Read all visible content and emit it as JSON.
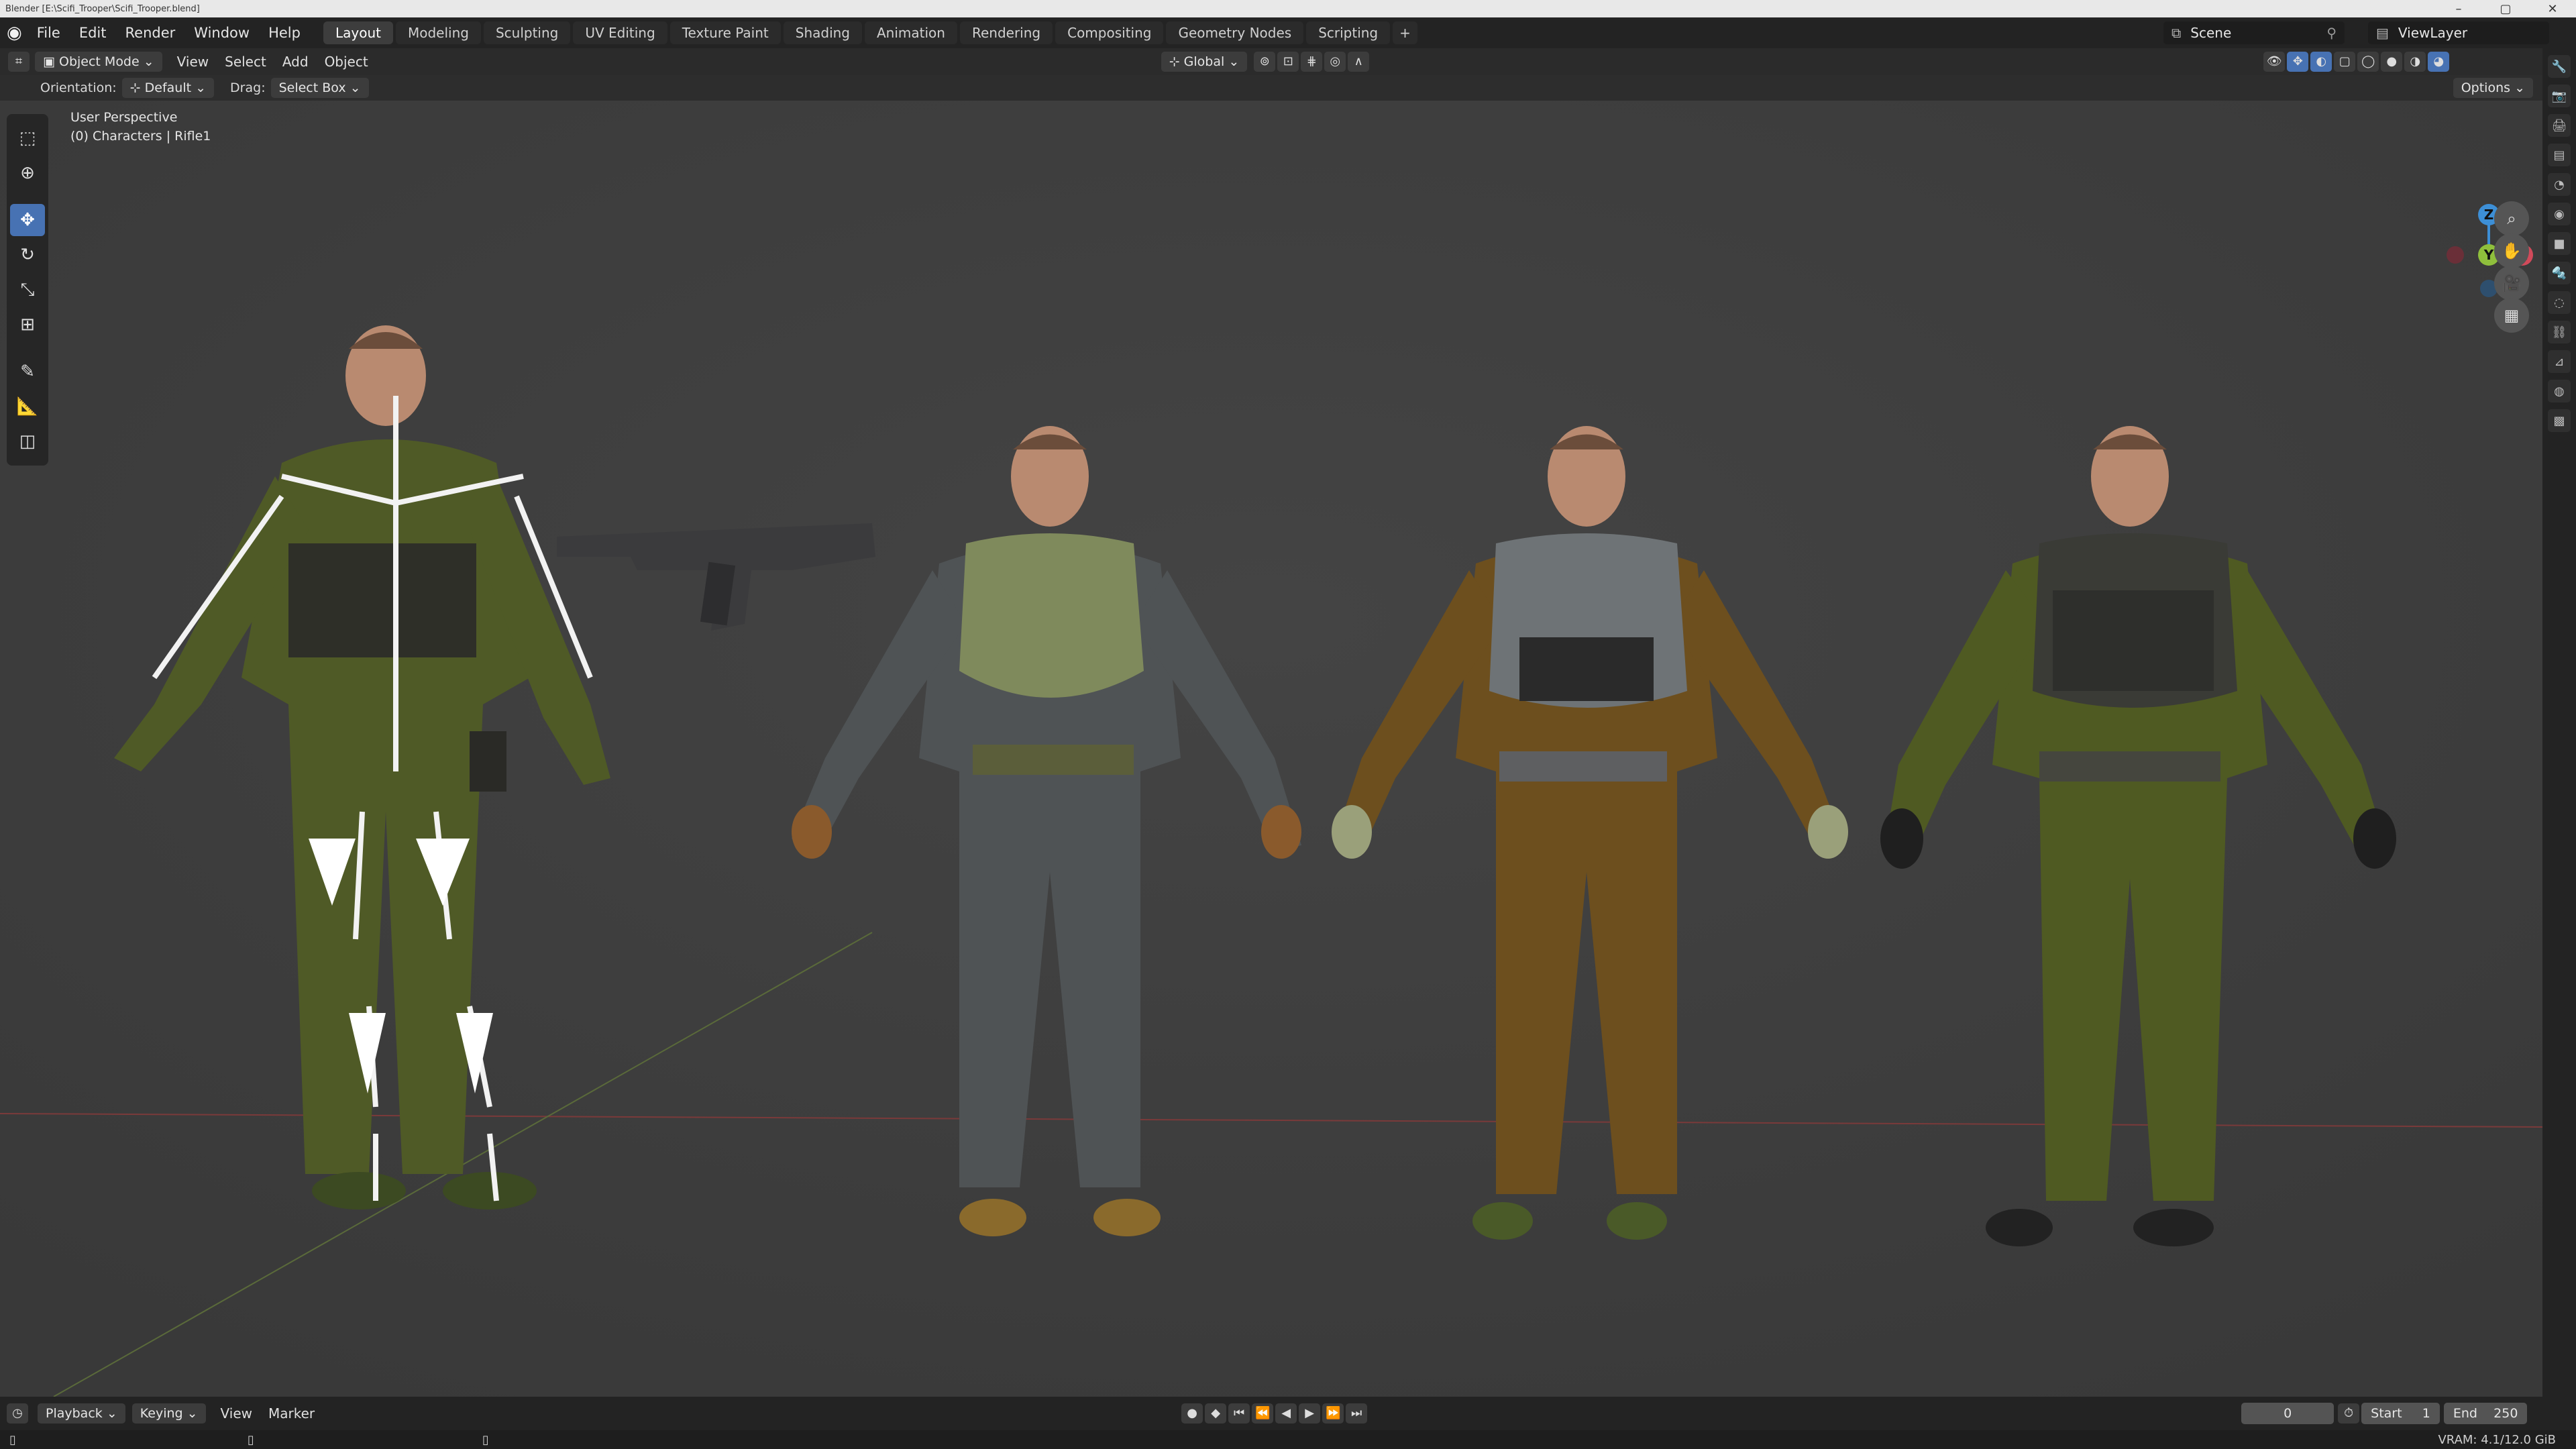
{
  "window": {
    "title": "Blender [E:\\Scifi_Trooper\\Scifi_Trooper.blend]",
    "controls": [
      "–",
      "▢",
      "✕"
    ]
  },
  "menu": [
    "File",
    "Edit",
    "Render",
    "Window",
    "Help"
  ],
  "workspaces": [
    {
      "label": "Layout",
      "active": true
    },
    {
      "label": "Modeling"
    },
    {
      "label": "Sculpting"
    },
    {
      "label": "UV Editing"
    },
    {
      "label": "Texture Paint"
    },
    {
      "label": "Shading"
    },
    {
      "label": "Animation"
    },
    {
      "label": "Rendering"
    },
    {
      "label": "Compositing"
    },
    {
      "label": "Geometry Nodes"
    },
    {
      "label": "Scripting"
    }
  ],
  "add_workspace": "+",
  "scene": {
    "label": "Scene"
  },
  "viewlayer": {
    "label": "ViewLayer"
  },
  "header": {
    "mode": "Object Mode",
    "menus": [
      "View",
      "Select",
      "Add",
      "Object"
    ],
    "transform_orientation": "Global"
  },
  "tool_settings": {
    "orientation_label": "Orientation:",
    "orientation_value": "Default",
    "drag_label": "Drag:",
    "drag_value": "Select Box",
    "options": "Options"
  },
  "viewport": {
    "perspective": "User Perspective",
    "collection_info": "(0) Characters | Rifle1",
    "gizmo_axes": {
      "z": "Z",
      "y": "Y",
      "x": "X"
    }
  },
  "timeline": {
    "playback": "Playback",
    "keying": "Keying",
    "view": "View",
    "marker": "Marker",
    "current_frame": "0",
    "start_label": "Start",
    "start": "1",
    "end_label": "End",
    "end": "250"
  },
  "status": {
    "vram": "VRAM: 4.1/12.0 GiB"
  },
  "colors": {
    "accent": "#4772b3",
    "viewport_bg": "#3d3d3d",
    "x_axis": "#d14a5a",
    "y_axis": "#8fbf3c",
    "z_axis": "#3d8fd6"
  }
}
